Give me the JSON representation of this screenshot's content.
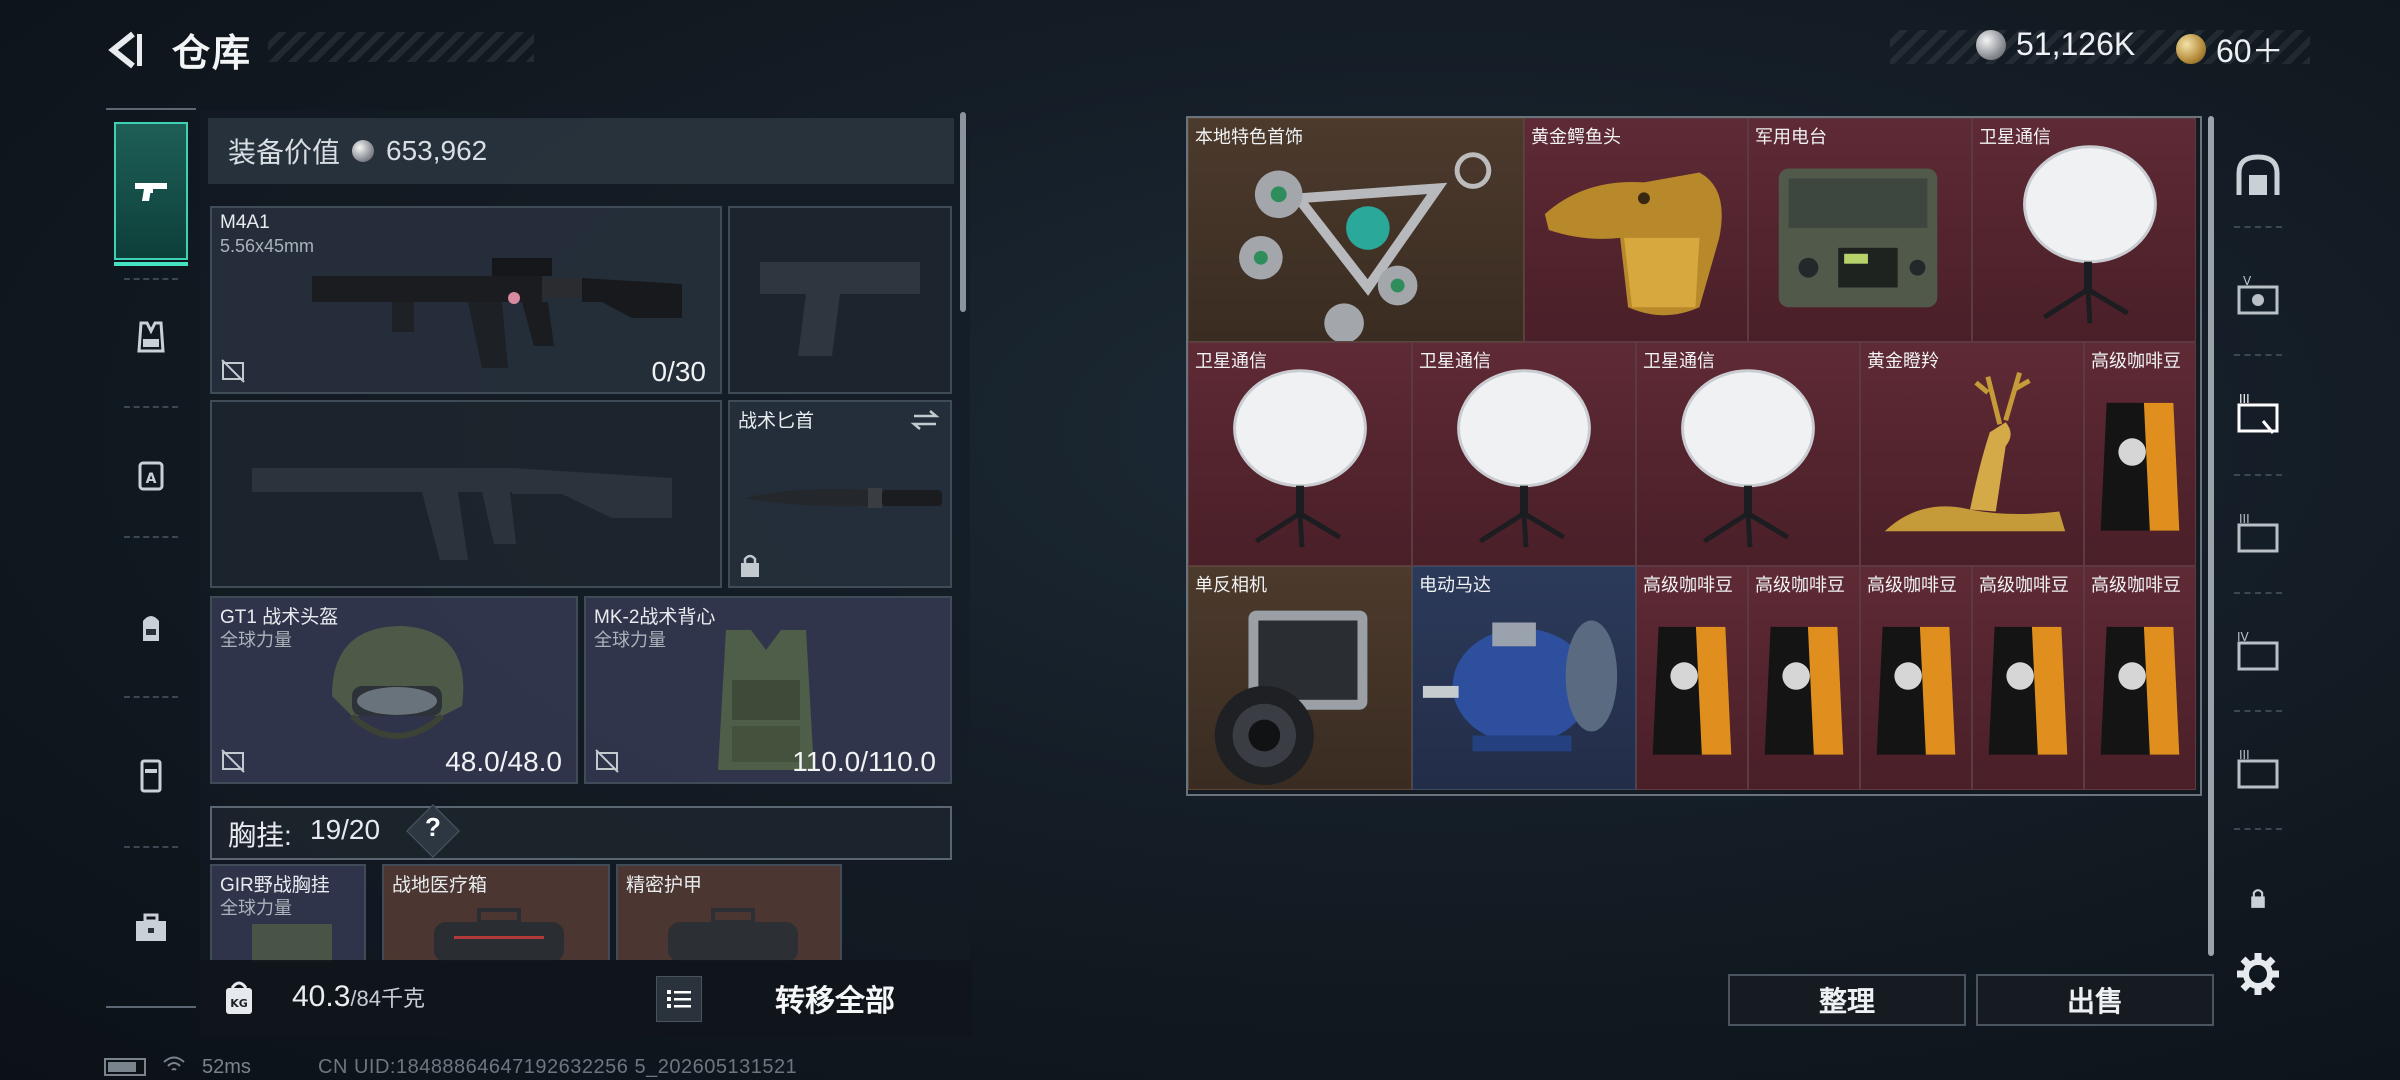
{
  "header": {
    "title": "仓库",
    "currency": [
      {
        "icon": "silver-coin-icon",
        "value": "51,126K"
      },
      {
        "icon": "gold-coin-icon",
        "value": "60＋"
      }
    ]
  },
  "leftnav": {
    "items": [
      {
        "name": "weapons",
        "icon": "pistol-icon",
        "active": true
      },
      {
        "name": "armor",
        "icon": "vest-icon"
      },
      {
        "name": "backpack-a",
        "icon": "backpack-a-icon"
      },
      {
        "name": "backpack",
        "icon": "backpack-icon"
      },
      {
        "name": "container",
        "icon": "container-icon"
      },
      {
        "name": "toolbox",
        "icon": "toolbox-icon"
      }
    ]
  },
  "equipment": {
    "value_label": "装备价值",
    "value": "653,962",
    "primary": {
      "name": "M4A1",
      "caliber": "5.56x45mm",
      "ammo": "0/30"
    },
    "melee": {
      "name": "战术匕首"
    },
    "helmet": {
      "name": "GT1 战术头盔",
      "brand": "全球力量",
      "durability": "48.0/48.0"
    },
    "armor": {
      "name": "MK-2战术背心",
      "brand": "全球力量",
      "durability": "110.0/110.0"
    },
    "chest_label": "胸挂:",
    "chest_count": "19/20",
    "chest_help": "?",
    "rig_items": [
      {
        "name": "GIR野战胸挂",
        "brand": "全球力量"
      },
      {
        "name": "战地医疗箱"
      },
      {
        "name": "精密护甲"
      }
    ]
  },
  "bottom": {
    "weight": "40.3",
    "weight_max": "/84千克",
    "transfer_all": "转移全部"
  },
  "grid_items": [
    {
      "name": "本地特色首饰",
      "style": "gold"
    },
    {
      "name": "黄金鳄鱼头",
      "style": "red"
    },
    {
      "name": "军用电台",
      "style": "red"
    },
    {
      "name": "卫星通信",
      "style": "red"
    },
    {
      "name": "卫星通信",
      "style": "red"
    },
    {
      "name": "卫星通信",
      "style": "red"
    },
    {
      "name": "卫星通信",
      "style": "red"
    },
    {
      "name": "黄金瞪羚",
      "style": "red"
    },
    {
      "name": "高级咖啡豆",
      "style": "red"
    },
    {
      "name": "单反相机",
      "style": "gold"
    },
    {
      "name": "电动马达",
      "style": "blue"
    },
    {
      "name": "高级咖啡豆",
      "style": "red"
    },
    {
      "name": "高级咖啡豆",
      "style": "red"
    },
    {
      "name": "高级咖啡豆",
      "style": "red"
    },
    {
      "name": "高级咖啡豆",
      "style": "red"
    },
    {
      "name": "高级咖啡豆",
      "style": "red"
    }
  ],
  "actions": {
    "sort": "整理",
    "sell": "出售"
  },
  "rightnav": {
    "items": [
      "safe-icon",
      "case-v-icon",
      "case-iii-icon",
      "case-ii-icon",
      "case-iv-icon",
      "case-ii-b-icon",
      "lock-icon",
      "gear-icon"
    ]
  },
  "status": {
    "ping": "52ms",
    "uid": "CN UID:18488864647192632256 5_202605131521"
  }
}
